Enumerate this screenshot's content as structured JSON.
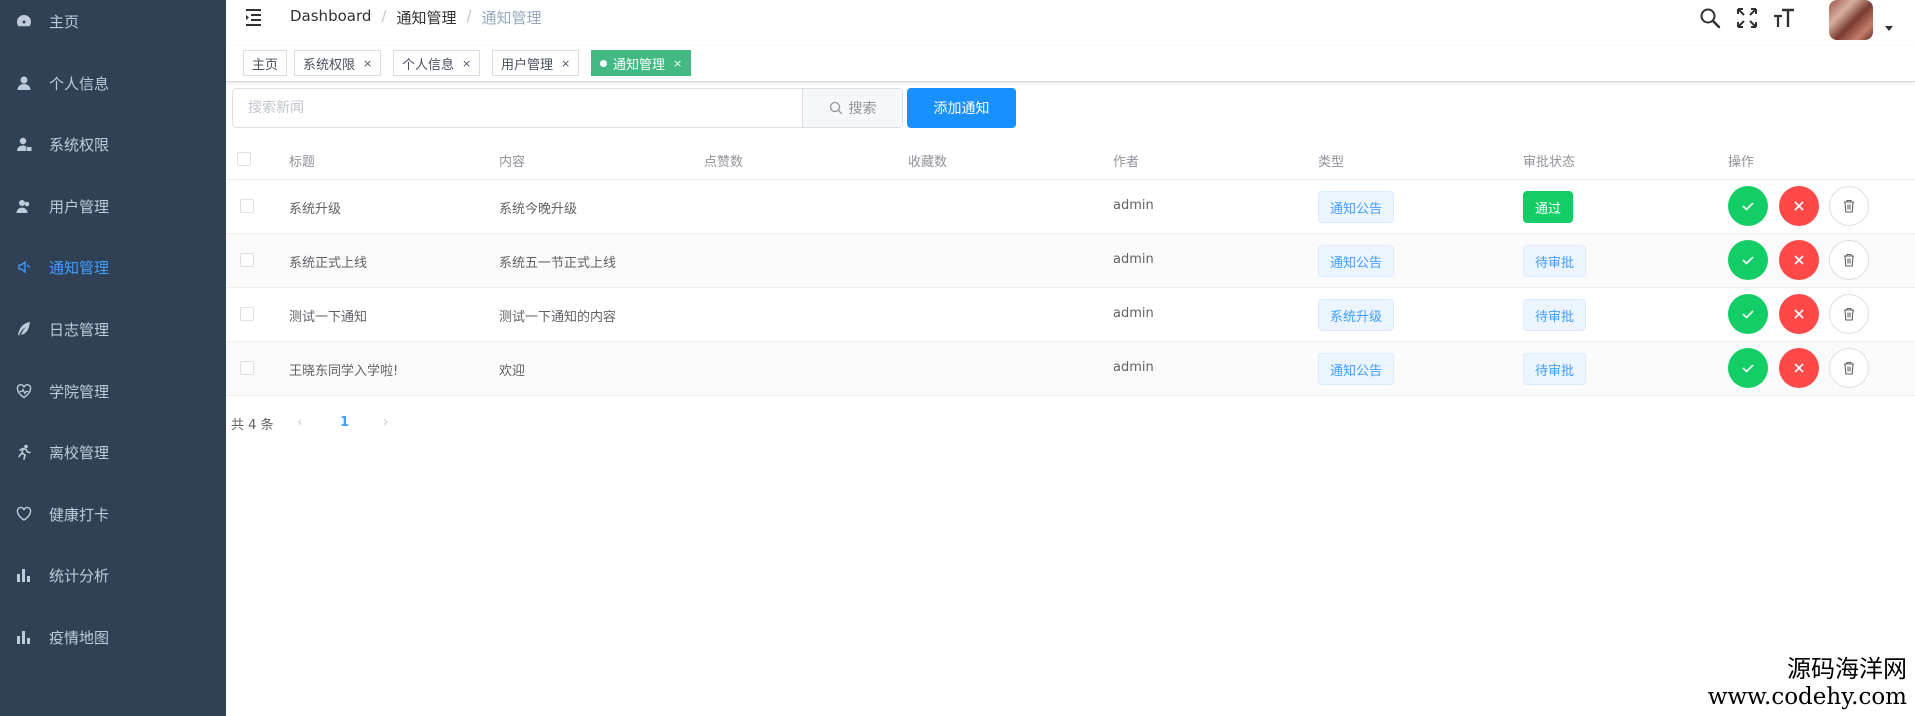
{
  "sidebar": {
    "items": [
      {
        "label": "主页",
        "icon": "dashboard-icon"
      },
      {
        "label": "个人信息",
        "icon": "user-icon"
      },
      {
        "label": "系统权限",
        "icon": "user-lock-icon"
      },
      {
        "label": "用户管理",
        "icon": "users-icon"
      },
      {
        "label": "通知管理",
        "icon": "speaker-icon",
        "active": true
      },
      {
        "label": "日志管理",
        "icon": "feather-icon"
      },
      {
        "label": "学院管理",
        "icon": "heart-pulse-icon"
      },
      {
        "label": "离校管理",
        "icon": "running-icon"
      },
      {
        "label": "健康打卡",
        "icon": "heart-icon"
      },
      {
        "label": "统计分析",
        "icon": "bar-chart-icon"
      },
      {
        "label": "疫情地图",
        "icon": "bar-chart-icon"
      }
    ]
  },
  "breadcrumb": {
    "items": [
      "Dashboard",
      "通知管理",
      "通知管理"
    ]
  },
  "tags": [
    {
      "label": "主页",
      "closable": false
    },
    {
      "label": "系统权限",
      "closable": true
    },
    {
      "label": "个人信息",
      "closable": true
    },
    {
      "label": "用户管理",
      "closable": true
    },
    {
      "label": "通知管理",
      "closable": true,
      "active": true
    }
  ],
  "toolbar": {
    "search_placeholder": "搜索新闻",
    "search_button": "搜索",
    "add_button": "添加通知"
  },
  "table": {
    "headers": [
      "标题",
      "内容",
      "点赞数",
      "收藏数",
      "作者",
      "类型",
      "审批状态",
      "操作"
    ],
    "rows": [
      {
        "title": "系统升级",
        "content": "系统今晚升级",
        "likes": "",
        "favorites": "",
        "author": "admin",
        "type": "通知公告",
        "status": "通过"
      },
      {
        "title": "系统正式上线",
        "content": "系统五一节正式上线",
        "likes": "",
        "favorites": "",
        "author": "admin",
        "type": "通知公告",
        "status": "待审批"
      },
      {
        "title": "测试一下通知",
        "content": "测试一下通知的内容",
        "likes": "",
        "favorites": "",
        "author": "admin",
        "type": "系统升级",
        "status": "待审批"
      },
      {
        "title": "王晓东同学入学啦!",
        "content": "欢迎",
        "likes": "",
        "favorites": "",
        "author": "admin",
        "type": "通知公告",
        "status": "待审批"
      }
    ]
  },
  "pagination": {
    "total_text": "共 4 条",
    "current_page": "1"
  },
  "watermark": {
    "line1": "源码海洋网",
    "line2": "www.codehy.com"
  },
  "colors": {
    "sidebar_bg": "#304156",
    "active": "#409eff",
    "success": "#13ce66",
    "danger": "#ff4949",
    "tag_active": "#42b983",
    "primary_button": "#1890ff"
  }
}
